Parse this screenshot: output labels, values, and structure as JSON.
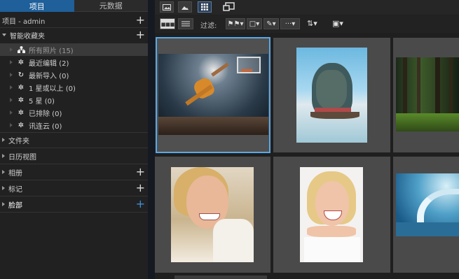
{
  "tabs": [
    "项目",
    "元数据"
  ],
  "project": {
    "label": "项目 - admin"
  },
  "smart_collections": {
    "label": "智能收藏夹",
    "items": [
      {
        "label": "所有照片 (15)"
      },
      {
        "label": "最近编辑 (2)"
      },
      {
        "label": "最新导入 (0)"
      },
      {
        "label": "1 星或以上 (0)"
      },
      {
        "label": "5 星 (0)"
      },
      {
        "label": "已排除 (0)"
      },
      {
        "label": "讯连云 (0)"
      }
    ]
  },
  "sections": [
    {
      "label": "文件夹"
    },
    {
      "label": "日历视图"
    },
    {
      "label": "相册"
    },
    {
      "label": "标记"
    },
    {
      "label": "脸部"
    }
  ],
  "toolbar": {
    "filter_label": "过滤:"
  },
  "colors": {
    "accent": "#1f5f9a",
    "selection": "#5aa8e8",
    "add_blue": "#3f8fd8"
  },
  "icons": [
    "view-library-icon",
    "view-landscape-icon",
    "view-grid-icon",
    "fullscreen-icon",
    "thumb-small-icon",
    "thumb-list-icon",
    "flag-filter-icon",
    "label-filter-icon",
    "edit-filter-icon",
    "more-filter-icon",
    "sort-icon",
    "stack-icon"
  ],
  "photos": [
    "basketball-dunk",
    "rock-island-boat",
    "forest",
    "smiling-woman",
    "laughing-girl",
    "ocean-wave"
  ]
}
